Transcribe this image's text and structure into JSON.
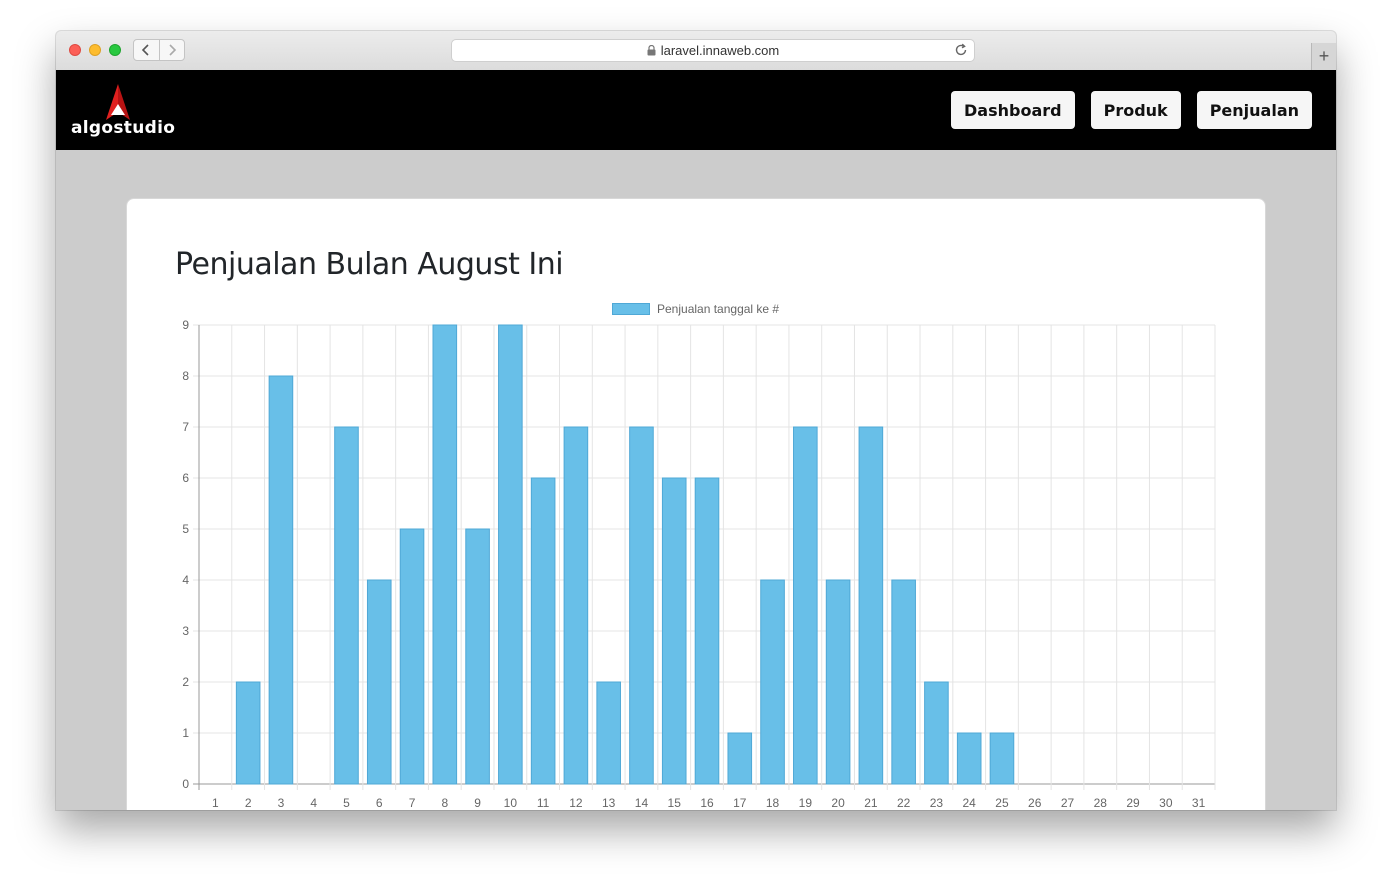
{
  "browser": {
    "url": "laravel.innaweb.com",
    "new_tab_label": "+"
  },
  "header": {
    "logo_text": "algostudio",
    "nav": [
      {
        "label": "Dashboard"
      },
      {
        "label": "Produk"
      },
      {
        "label": "Penjualan"
      }
    ]
  },
  "main": {
    "title": "Penjualan Bulan August Ini"
  },
  "colors": {
    "bar_fill": "#68bfe8",
    "bar_border": "#4fa8d6",
    "header_bg": "#000000",
    "page_bg": "#cccccc"
  },
  "chart_data": {
    "type": "bar",
    "title": "",
    "xlabel": "",
    "ylabel": "",
    "legend": "top",
    "grid": true,
    "ylim": [
      0,
      9
    ],
    "yticks": [
      0,
      1,
      2,
      3,
      4,
      5,
      6,
      7,
      8,
      9
    ],
    "categories": [
      "1",
      "2",
      "3",
      "4",
      "5",
      "6",
      "7",
      "8",
      "9",
      "10",
      "11",
      "12",
      "13",
      "14",
      "15",
      "16",
      "17",
      "18",
      "19",
      "20",
      "21",
      "22",
      "23",
      "24",
      "25",
      "26",
      "27",
      "28",
      "29",
      "30",
      "31"
    ],
    "series": [
      {
        "name": "Penjualan tanggal ke #",
        "values": [
          0,
          2,
          8,
          0,
          7,
          4,
          5,
          9,
          5,
          9,
          6,
          7,
          2,
          7,
          6,
          6,
          1,
          4,
          7,
          4,
          7,
          4,
          2,
          1,
          1,
          0,
          0,
          0,
          0,
          0,
          0
        ]
      }
    ]
  }
}
